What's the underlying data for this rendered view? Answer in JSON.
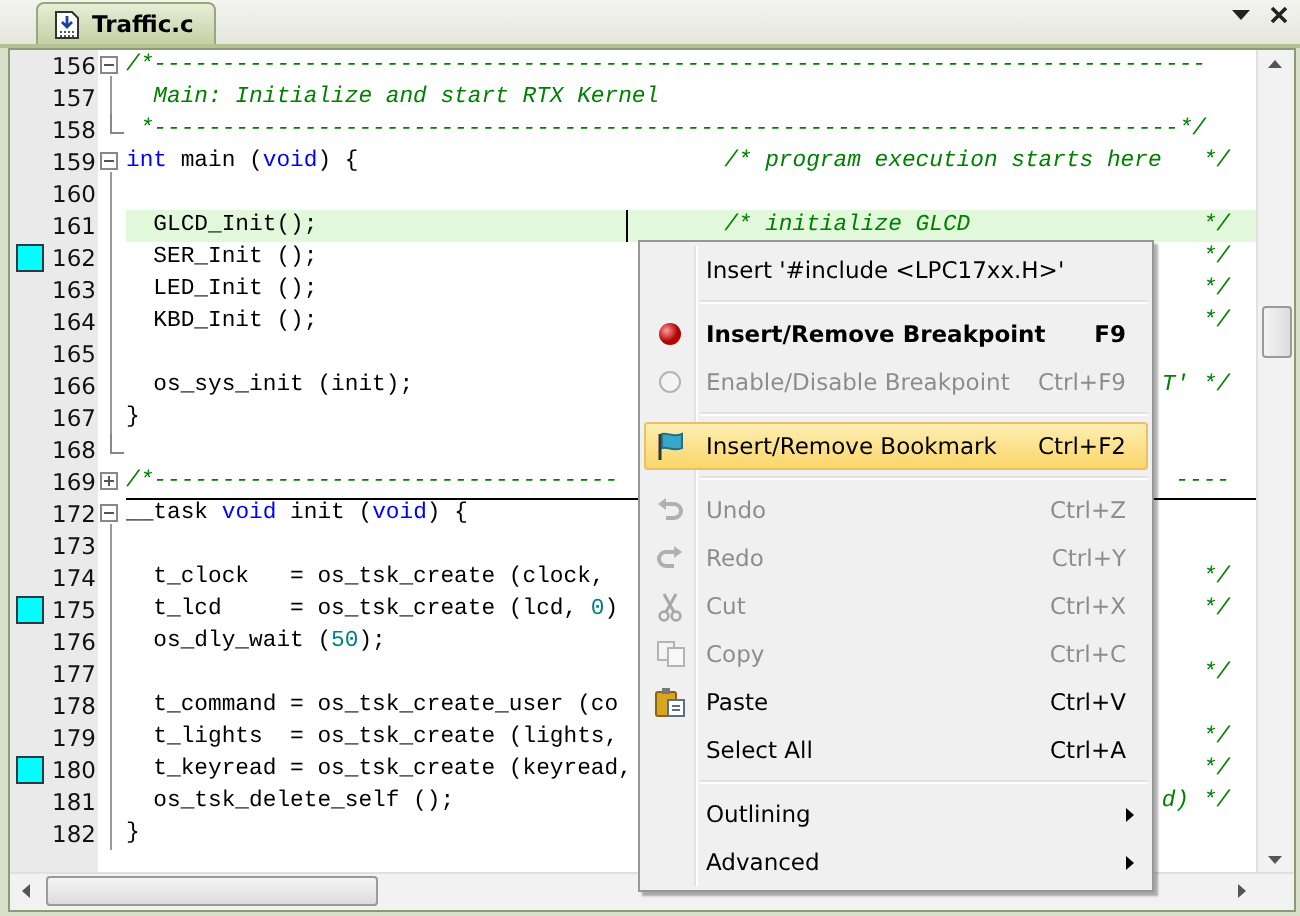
{
  "tab": {
    "label": "Traffic.c",
    "selected": true
  },
  "lines": [
    {
      "number": "156",
      "fold_start": true,
      "expanded": true,
      "fold_end": false,
      "bookmark": false,
      "current": false,
      "code": [
        {
          "kind": "comment",
          "text": "/*-----------------------------------------------------------------------------"
        }
      ]
    },
    {
      "number": "157",
      "fold_start": false,
      "fold_end": false,
      "bookmark": false,
      "current": false,
      "code": [
        {
          "kind": "comment",
          "text": "  Main: Initialize and start RTX Kernel"
        }
      ]
    },
    {
      "number": "158",
      "fold_start": false,
      "fold_end": true,
      "bookmark": false,
      "current": false,
      "code": [
        {
          "kind": "comment",
          "text": " *---------------------------------------------------------------------------*/"
        }
      ]
    },
    {
      "number": "159",
      "fold_start": true,
      "expanded": true,
      "fold_end": false,
      "bookmark": false,
      "current": false,
      "code": [
        {
          "kind": "keyword",
          "text": "int"
        },
        {
          "kind": "plain",
          "text": " main ("
        },
        {
          "kind": "keyword",
          "text": "void"
        },
        {
          "kind": "plain",
          "text": ") {"
        }
      ],
      "right": [
        {
          "kind": "comment",
          "text": "/* program execution starts here   */"
        }
      ]
    },
    {
      "number": "160",
      "fold_start": false,
      "fold_end": false,
      "bookmark": false,
      "current": false
    },
    {
      "number": "161",
      "fold_start": false,
      "fold_end": false,
      "bookmark": false,
      "current": true,
      "caret": true,
      "code": [
        {
          "kind": "plain",
          "text": "  GLCD_Init();"
        }
      ],
      "right": [
        {
          "kind": "comment",
          "text": "/* initialize GLCD                 */"
        }
      ]
    },
    {
      "number": "162",
      "fold_start": false,
      "fold_end": false,
      "bookmark": true,
      "current": false,
      "code": [
        {
          "kind": "plain",
          "text": "  SER_Init ();"
        }
      ],
      "right": [
        {
          "kind": "comment",
          "text": "*/"
        }
      ]
    },
    {
      "number": "163",
      "fold_start": false,
      "fold_end": false,
      "bookmark": false,
      "current": false,
      "code": [
        {
          "kind": "plain",
          "text": "  LED_Init ();"
        }
      ],
      "right": [
        {
          "kind": "comment",
          "text": "*/"
        }
      ]
    },
    {
      "number": "164",
      "fold_start": false,
      "fold_end": false,
      "bookmark": false,
      "current": false,
      "code": [
        {
          "kind": "plain",
          "text": "  KBD_Init ();"
        }
      ],
      "right": [
        {
          "kind": "comment",
          "text": "*/"
        }
      ]
    },
    {
      "number": "165",
      "fold_start": false,
      "fold_end": false,
      "bookmark": false,
      "current": false
    },
    {
      "number": "166",
      "fold_start": false,
      "fold_end": false,
      "bookmark": false,
      "current": false,
      "code": [
        {
          "kind": "plain",
          "text": "  os_sys_init (init);"
        }
      ],
      "right": [
        {
          "kind": "comment",
          "text": "T' */"
        }
      ]
    },
    {
      "number": "167",
      "fold_start": false,
      "fold_end": false,
      "bookmark": false,
      "current": false,
      "code": [
        {
          "kind": "plain",
          "text": "}"
        }
      ]
    },
    {
      "number": "168",
      "fold_start": false,
      "fold_end": true,
      "bookmark": false,
      "current": false
    },
    {
      "number": "169",
      "fold_start": true,
      "expanded": false,
      "fold_end": false,
      "bookmark": false,
      "current": false,
      "code": [
        {
          "kind": "comment",
          "text": "/*----------------------------------"
        }
      ],
      "right": [
        {
          "kind": "comment",
          "text": "----"
        }
      ]
    },
    {
      "number": "172",
      "fold_start": true,
      "expanded": true,
      "fold_end": false,
      "bookmark": false,
      "current": false,
      "code": [
        {
          "kind": "plain",
          "text": "__task "
        },
        {
          "kind": "keyword",
          "text": "void"
        },
        {
          "kind": "plain",
          "text": " init ("
        },
        {
          "kind": "keyword",
          "text": "void"
        },
        {
          "kind": "plain",
          "text": ") {"
        }
      ]
    },
    {
      "number": "173",
      "fold_start": false,
      "fold_end": false,
      "bookmark": false,
      "current": false
    },
    {
      "number": "174",
      "fold_start": false,
      "fold_end": false,
      "bookmark": false,
      "current": false,
      "code": [
        {
          "kind": "plain",
          "text": "  t_clock   = os_tsk_create (clock,"
        }
      ],
      "right": [
        {
          "kind": "comment",
          "text": "*/"
        }
      ]
    },
    {
      "number": "175",
      "fold_start": false,
      "fold_end": false,
      "bookmark": true,
      "current": false,
      "code": [
        {
          "kind": "plain",
          "text": "  t_lcd     = os_tsk_create (lcd, "
        },
        {
          "kind": "number",
          "text": "0"
        },
        {
          "kind": "plain",
          "text": ")"
        }
      ],
      "right": [
        {
          "kind": "comment",
          "text": "*/"
        }
      ]
    },
    {
      "number": "176",
      "fold_start": false,
      "fold_end": false,
      "bookmark": false,
      "current": false,
      "code": [
        {
          "kind": "plain",
          "text": "  os_dly_wait ("
        },
        {
          "kind": "number",
          "text": "50"
        },
        {
          "kind": "plain",
          "text": ");"
        }
      ]
    },
    {
      "number": "177",
      "fold_start": false,
      "fold_end": false,
      "bookmark": false,
      "current": false,
      "right": [
        {
          "kind": "comment",
          "text": "*/"
        }
      ]
    },
    {
      "number": "178",
      "fold_start": false,
      "fold_end": false,
      "bookmark": false,
      "current": false,
      "code": [
        {
          "kind": "plain",
          "text": "  t_command = os_tsk_create_user (co"
        }
      ]
    },
    {
      "number": "179",
      "fold_start": false,
      "fold_end": false,
      "bookmark": false,
      "current": false,
      "code": [
        {
          "kind": "plain",
          "text": "  t_lights  = os_tsk_create (lights,"
        }
      ],
      "right": [
        {
          "kind": "comment",
          "text": "*/"
        }
      ]
    },
    {
      "number": "180",
      "fold_start": false,
      "fold_end": false,
      "bookmark": true,
      "current": false,
      "code": [
        {
          "kind": "plain",
          "text": "  t_keyread = os_tsk_create (keyread,"
        }
      ],
      "right": [
        {
          "kind": "comment",
          "text": "*/"
        }
      ]
    },
    {
      "number": "181",
      "fold_start": false,
      "fold_end": false,
      "bookmark": false,
      "current": false,
      "code": [
        {
          "kind": "plain",
          "text": "  os_tsk_delete_self ();"
        }
      ],
      "right": [
        {
          "kind": "comment",
          "text": "d) */"
        }
      ]
    },
    {
      "number": "182",
      "fold_start": false,
      "fold_end": false,
      "bookmark": false,
      "current": false,
      "code": [
        {
          "kind": "plain",
          "text": "}"
        }
      ]
    }
  ],
  "context_menu": [
    {
      "kind": "item",
      "label": "Insert '#include <LPC17xx.H>'",
      "selected": false,
      "disabled": false,
      "default": false,
      "submenu": false
    },
    {
      "kind": "separator"
    },
    {
      "kind": "item",
      "label": "Insert/Remove Breakpoint",
      "shortcut": "F9",
      "selected": false,
      "disabled": false,
      "default": true,
      "submenu": false
    },
    {
      "kind": "item",
      "label": "Enable/Disable Breakpoint",
      "shortcut": "Ctrl+F9",
      "selected": false,
      "disabled": true,
      "default": false,
      "submenu": false
    },
    {
      "kind": "separator"
    },
    {
      "kind": "item",
      "label": "Insert/Remove Bookmark",
      "shortcut": "Ctrl+F2",
      "selected": true,
      "disabled": false,
      "default": false,
      "submenu": false
    },
    {
      "kind": "separator"
    },
    {
      "kind": "item",
      "label": "Undo",
      "shortcut": "Ctrl+Z",
      "selected": false,
      "disabled": true,
      "default": false,
      "submenu": false
    },
    {
      "kind": "item",
      "label": "Redo",
      "shortcut": "Ctrl+Y",
      "selected": false,
      "disabled": true,
      "default": false,
      "submenu": false
    },
    {
      "kind": "item",
      "label": "Cut",
      "shortcut": "Ctrl+X",
      "selected": false,
      "disabled": true,
      "default": false,
      "submenu": false
    },
    {
      "kind": "item",
      "label": "Copy",
      "shortcut": "Ctrl+C",
      "selected": false,
      "disabled": true,
      "default": false,
      "submenu": false
    },
    {
      "kind": "item",
      "label": "Paste",
      "shortcut": "Ctrl+V",
      "selected": false,
      "disabled": false,
      "default": false,
      "submenu": false
    },
    {
      "kind": "item",
      "label": "Select All",
      "shortcut": "Ctrl+A",
      "selected": false,
      "disabled": false,
      "default": false,
      "submenu": false
    },
    {
      "kind": "separator"
    },
    {
      "kind": "item",
      "label": "Outlining",
      "submenu": true,
      "selected": false,
      "disabled": false,
      "default": false
    },
    {
      "kind": "item",
      "label": "Advanced",
      "submenu": true,
      "selected": false,
      "disabled": false,
      "default": false
    }
  ]
}
